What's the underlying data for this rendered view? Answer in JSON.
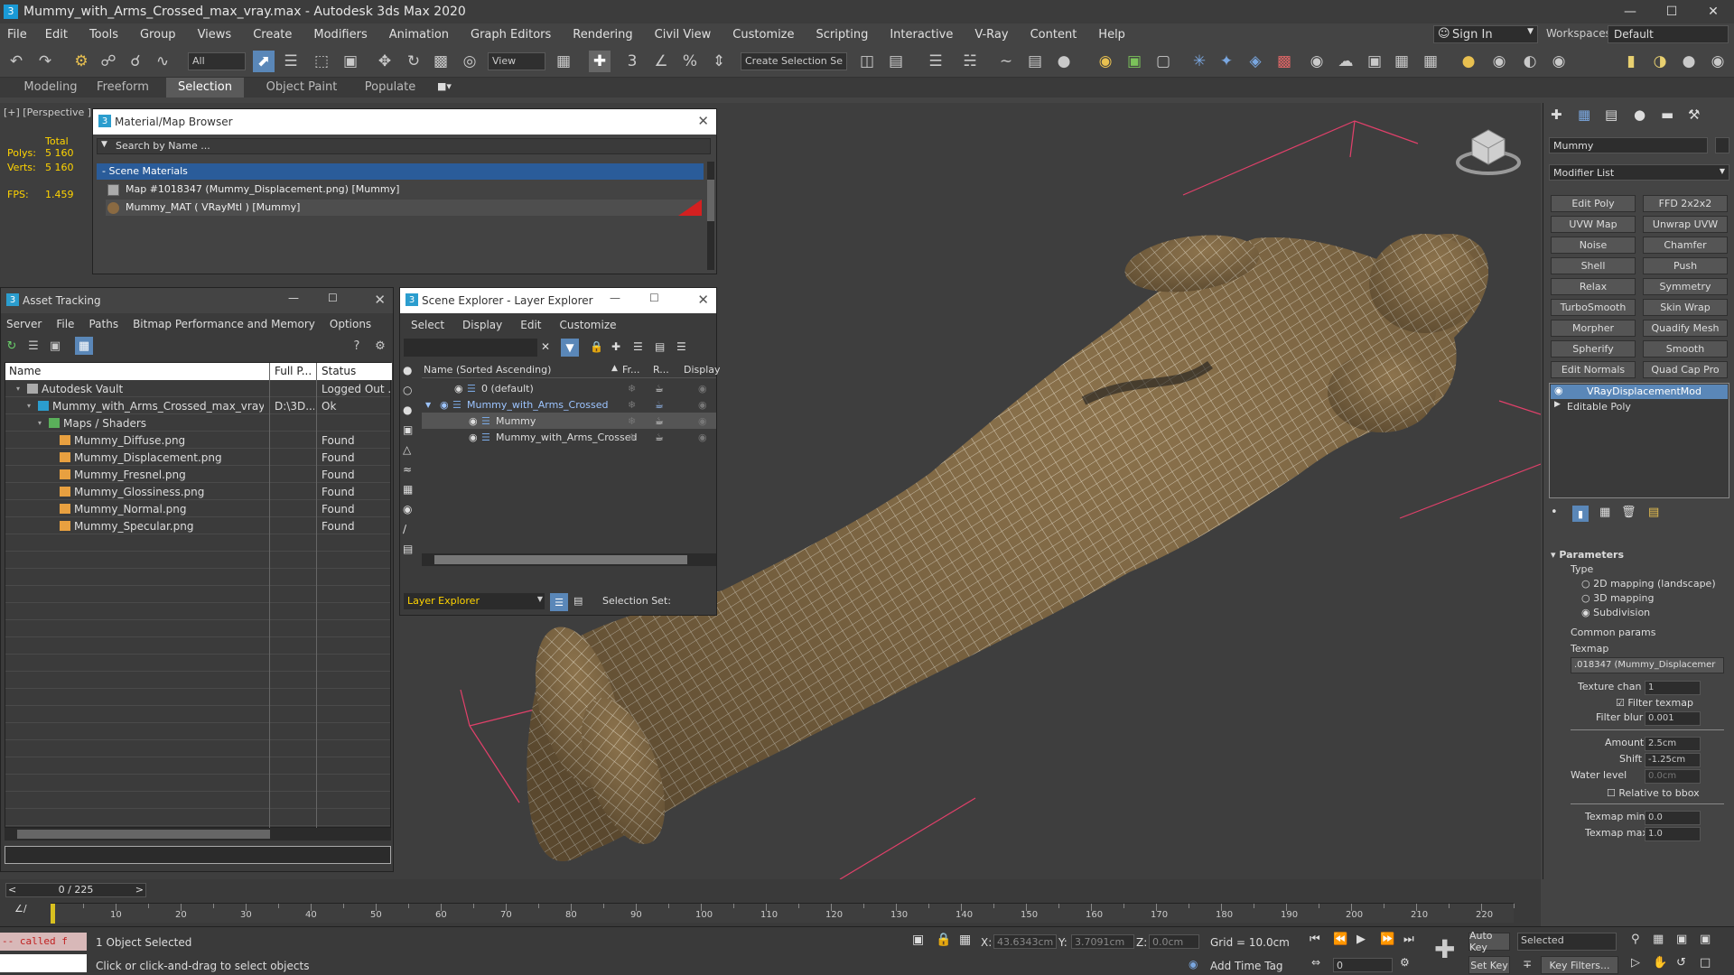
{
  "titlebar": {
    "title": "Mummy_with_Arms_Crossed_max_vray.max - Autodesk 3ds Max 2020"
  },
  "menus": [
    "File",
    "Edit",
    "Tools",
    "Group",
    "Views",
    "Create",
    "Modifiers",
    "Animation",
    "Graph Editors",
    "Rendering",
    "Civil View",
    "Customize",
    "Scripting",
    "Interactive",
    "V-Ray",
    "Content",
    "Help"
  ],
  "account": {
    "signin": "Sign In",
    "workspaces_label": "Workspaces:",
    "workspace": "Default"
  },
  "toolbar": {
    "filter": "All",
    "refcoord": "View",
    "selset": "Create Selection Se"
  },
  "ribbon": {
    "tabs": [
      "Modeling",
      "Freeform",
      "Selection",
      "Object Paint",
      "Populate"
    ]
  },
  "viewport": {
    "label": "[+] [Perspective ] [",
    "stats": {
      "total": "Total",
      "polys_label": "Polys:",
      "polys": "5 160",
      "verts_label": "Verts:",
      "verts": "5 160",
      "fps_label": "FPS:",
      "fps": "1.459"
    }
  },
  "material_browser": {
    "title": "Material/Map Browser",
    "search": "Search by Name ...",
    "group": "- Scene Materials",
    "items": [
      "Map #1018347 (Mummy_Displacement.png) [Mummy]",
      "Mummy_MAT ( VRayMtl ) [Mummy]"
    ]
  },
  "asset_tracking": {
    "title": "Asset Tracking",
    "menus": [
      "Server",
      "File",
      "Paths",
      "Bitmap Performance and Memory",
      "Options"
    ],
    "columns": [
      "Name",
      "Full P...",
      "Status"
    ],
    "rows": [
      {
        "name": "Autodesk Vault",
        "path": "",
        "status": "Logged Out ...",
        "indent": 1
      },
      {
        "name": "Mummy_with_Arms_Crossed_max_vray.m...",
        "path": "D:\\3D...",
        "status": "Ok",
        "indent": 2
      },
      {
        "name": "Maps / Shaders",
        "path": "",
        "status": "",
        "indent": 3
      },
      {
        "name": "Mummy_Diffuse.png",
        "path": "",
        "status": "Found",
        "indent": 4
      },
      {
        "name": "Mummy_Displacement.png",
        "path": "",
        "status": "Found",
        "indent": 4
      },
      {
        "name": "Mummy_Fresnel.png",
        "path": "",
        "status": "Found",
        "indent": 4
      },
      {
        "name": "Mummy_Glossiness.png",
        "path": "",
        "status": "Found",
        "indent": 4
      },
      {
        "name": "Mummy_Normal.png",
        "path": "",
        "status": "Found",
        "indent": 4
      },
      {
        "name": "Mummy_Specular.png",
        "path": "",
        "status": "Found",
        "indent": 4
      }
    ]
  },
  "scene_explorer": {
    "title": "Scene Explorer - Layer Explorer",
    "menus": [
      "Select",
      "Display",
      "Edit",
      "Customize"
    ],
    "columns": [
      "Name (Sorted Ascending)",
      "Fr...",
      "R...",
      "Display"
    ],
    "rows": [
      {
        "name": "0 (default)",
        "indent": 1
      },
      {
        "name": "Mummy_with_Arms_Crossed",
        "indent": 0,
        "selected": true
      },
      {
        "name": "Mummy",
        "indent": 2
      },
      {
        "name": "Mummy_with_Arms_Crossed",
        "indent": 2
      }
    ],
    "footer": {
      "explorer": "Layer Explorer",
      "selset": "Selection Set:"
    }
  },
  "command_panel": {
    "object_name": "Mummy",
    "modifier_list": "Modifier List",
    "buttons": [
      "Edit Poly",
      "FFD 2x2x2",
      "UVW Map",
      "Unwrap UVW",
      "Noise",
      "Chamfer",
      "Shell",
      "Push",
      "Relax",
      "Symmetry",
      "TurboSmooth",
      "Skin Wrap",
      "Morpher",
      "Quadify Mesh",
      "Spherify",
      "Smooth",
      "Edit Normals",
      "Quad Cap Pro"
    ],
    "stack": [
      "VRayDisplacementMod",
      "Editable Poly"
    ],
    "params": {
      "title": "Parameters",
      "type": "Type",
      "types": [
        "2D mapping (landscape)",
        "3D mapping",
        "Subdivision"
      ],
      "common": "Common params",
      "texmap": "Texmap",
      "texmap_val": ".018347 (Mummy_Displacemer",
      "texture_chan": "Texture chan",
      "texture_chan_val": "1",
      "filter_texmap": "Filter texmap",
      "filter_blur": "Filter blur",
      "filter_blur_val": "0.001",
      "amount": "Amount",
      "amount_val": "2.5cm",
      "shift": "Shift",
      "shift_val": "-1.25cm",
      "water_level": "Water level",
      "water_level_val": "0.0cm",
      "relative": "Relative to bbox",
      "texmap_min": "Texmap min",
      "texmap_min_val": "0.0",
      "texmap_max": "Texmap max",
      "texmap_max_val": "1.0"
    }
  },
  "timeline": {
    "frame": "0 / 225",
    "ticks": [
      "10",
      "20",
      "30",
      "40",
      "50",
      "60",
      "70",
      "80",
      "90",
      "100",
      "110",
      "120",
      "130",
      "140",
      "150",
      "160",
      "170",
      "180",
      "190",
      "200",
      "210",
      "220"
    ],
    "progress": 0
  },
  "status": {
    "script": "-- called f",
    "selected": "1 Object Selected",
    "hint": "Click or click-and-drag to select objects",
    "x_label": "X:",
    "x": "43.6343cm",
    "y_label": "Y:",
    "y": "3.7091cm",
    "z_label": "Z:",
    "z": "0.0cm",
    "grid": "Grid = 10.0cm",
    "add_time_tag": "Add Time Tag",
    "autokey": "Auto Key",
    "setkey": "Set Key",
    "selected_dd": "Selected",
    "keyfilters": "Key Filters...",
    "frame_field": "0"
  },
  "colors": {
    "accent": "#5a87b8",
    "title_bg": "#3c3c3c",
    "viewport_bg": "#3e3e3e",
    "stats": "#ffd400",
    "found_icon": "#e8a040"
  }
}
